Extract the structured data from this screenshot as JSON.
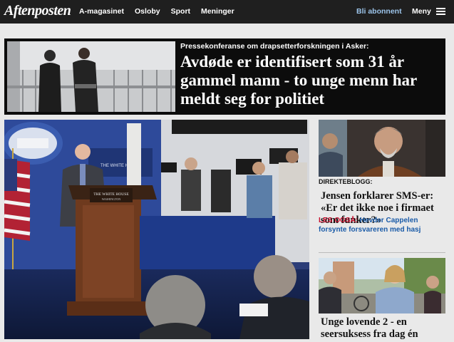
{
  "header": {
    "logo": "Aftenposten",
    "nav": [
      "A-magasinet",
      "Osloby",
      "Sport",
      "Meninger"
    ],
    "subscribe": "Bli abonnent",
    "menu": "Meny"
  },
  "breaking": {
    "kicker": "Pressekonferanse om drapsetterforskningen i Asker:",
    "title": "Avdøde er identifisert som 31 år gammel mann - to unge menn har meldt seg for politiet"
  },
  "main_photo": {
    "podium_text": "THE WHITE HOUSE",
    "podium_sub": "WASHINGTON",
    "wall_text": "THE WHITE HOUSE"
  },
  "side": {
    "live_label": "DIREKTEBLOGG:",
    "title1": "Jensen forklarer SMS-er: «Er det ikke noe i firmaet som funker?»",
    "also_label": "LES OGSÅ:",
    "also_text": "Hevder Cappelen forsynte forsvareren med hasj",
    "title2": "Unge lovende 2 - en seersuksess fra dag én"
  }
}
